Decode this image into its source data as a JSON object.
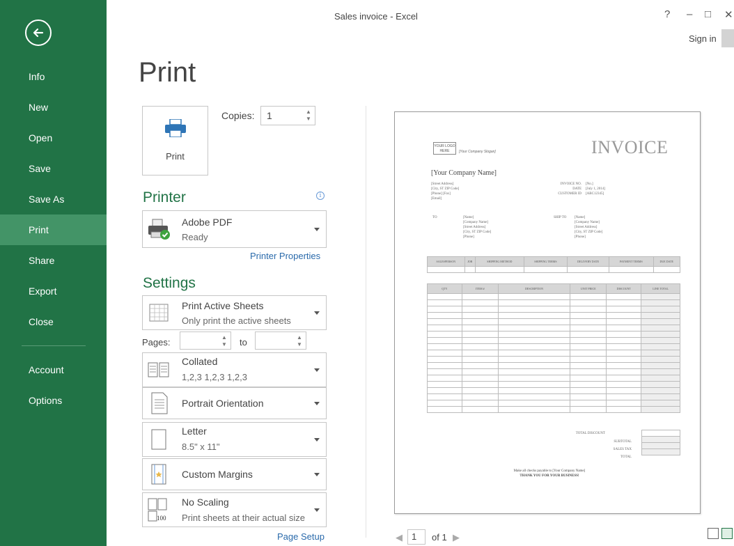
{
  "window": {
    "title": "Sales invoice - Excel",
    "help": "?",
    "minimize": "–",
    "maximize": "□",
    "close": "✕",
    "sign_in": "Sign in"
  },
  "sidebar": {
    "back_icon": "back-arrow-icon",
    "items": [
      {
        "label": "Info"
      },
      {
        "label": "New"
      },
      {
        "label": "Open"
      },
      {
        "label": "Save"
      },
      {
        "label": "Save As"
      },
      {
        "label": "Print",
        "active": true
      },
      {
        "label": "Share"
      },
      {
        "label": "Export"
      },
      {
        "label": "Close"
      },
      {
        "label": "Account"
      },
      {
        "label": "Options"
      }
    ]
  },
  "print": {
    "heading": "Print",
    "button_label": "Print",
    "copies_label": "Copies:",
    "copies_value": "1"
  },
  "printer": {
    "heading": "Printer",
    "name": "Adobe PDF",
    "status": "Ready",
    "properties_link": "Printer Properties"
  },
  "settings": {
    "heading": "Settings",
    "sheets": {
      "title": "Print Active Sheets",
      "subtitle": "Only print the active sheets"
    },
    "pages_label": "Pages:",
    "to_label": "to",
    "collation": {
      "title": "Collated",
      "subtitle": "1,2,3   1,2,3   1,2,3"
    },
    "orientation": {
      "title": "Portrait Orientation"
    },
    "paper": {
      "title": "Letter",
      "subtitle": "8.5\" x 11\""
    },
    "margins": {
      "title": "Custom Margins"
    },
    "scaling": {
      "title": "No Scaling",
      "subtitle": "Print sheets at their actual size",
      "icon_text": "100"
    },
    "page_setup_link": "Page Setup"
  },
  "preview": {
    "logo_text": "YOUR LOGO HERE",
    "slogan": "[Your Company Slogan]",
    "invoice_title": "INVOICE",
    "company_name": "[Your Company Name]",
    "company_address": [
      "[Street Address]",
      "[City, ST ZIP Code]",
      "[Phone] [Fax]",
      "[Email]"
    ],
    "invoice_meta_labels": [
      "INVOICE NO.",
      "DATE",
      "CUSTOMER ID"
    ],
    "invoice_meta_values": [
      "[No.]",
      "[July 1, 2014]",
      "[ABC12345]"
    ],
    "to_label": "TO",
    "ship_to_label": "SHIP TO",
    "to_lines": [
      "[Name]",
      "[Company Name]",
      "[Street Address]",
      "[City, ST ZIP Code]",
      "[Phone]"
    ],
    "ship_lines": [
      "[Name]",
      "[Company Name]",
      "[Street Address]",
      "[City, ST ZIP Code]",
      "[Phone]"
    ],
    "ship_headers": [
      "SALESPERSON",
      "JOB",
      "SHIPPING METHOD",
      "SHIPPING TERMS",
      "DELIVERY DATE",
      "PAYMENT TERMS",
      "DUE DATE"
    ],
    "item_headers": [
      "QTY",
      "ITEM #",
      "DESCRIPTION",
      "UNIT PRICE",
      "DISCOUNT",
      "LINE TOTAL"
    ],
    "total_discount_label": "TOTAL DISCOUNT",
    "totals_labels": [
      "SUBTOTAL",
      "SALES TAX",
      "TOTAL"
    ],
    "footer_line1": "Make all checks payable to [Your Company Name]",
    "footer_line2": "THANK YOU FOR YOUR BUSINESS!",
    "page_current": "1",
    "page_of": "of 1"
  }
}
